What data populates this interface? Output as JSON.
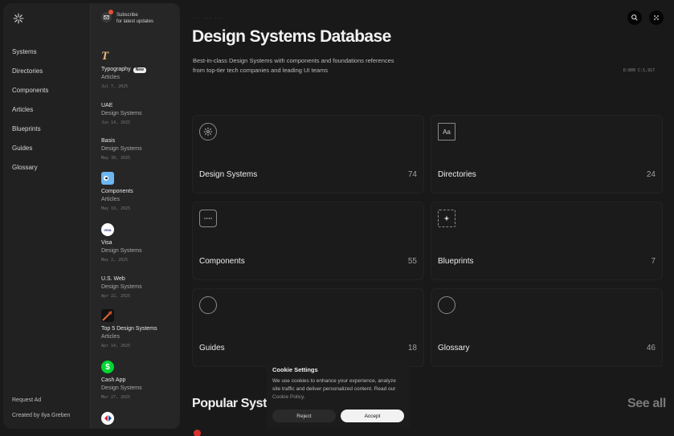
{
  "nav": {
    "items": [
      "Systems",
      "Directories",
      "Components",
      "Articles",
      "Blueprints",
      "Guides",
      "Glossary"
    ],
    "footer": [
      "Request Ad",
      "Created by Ilya Greben"
    ]
  },
  "subscribe": {
    "line1": "Subscribe",
    "line2": "for latest updates"
  },
  "feed": [
    {
      "title": "Typography",
      "badge": "New",
      "category": "Articles",
      "date": "Jul 7, 2025",
      "icon": "T"
    },
    {
      "title": "UAE",
      "category": "Design Systems",
      "date": "Jun 14, 2025",
      "icon": ""
    },
    {
      "title": "Basis",
      "category": "Design Systems",
      "date": "May 30, 2025",
      "icon": ""
    },
    {
      "title": "Components",
      "category": "Articles",
      "date": "May 19, 2025",
      "icon": ""
    },
    {
      "title": "Visa",
      "category": "Design Systems",
      "date": "May 2, 2025",
      "icon": "VISA"
    },
    {
      "title": "U.S. Web",
      "category": "Design Systems",
      "date": "Apr 22, 2025",
      "icon": ""
    },
    {
      "title": "Top 5 Design Systems",
      "category": "Articles",
      "date": "Apr 14, 2025",
      "icon": ""
    },
    {
      "title": "Cash App",
      "category": "Design Systems",
      "date": "Mar 27, 2025",
      "icon": "$"
    }
  ],
  "header": {
    "overline": "--- --- ---",
    "title": "Design Systems Database",
    "description": "Best-in-class Design Systems with components and foundations references from top-tier tech companies and leading UI teams",
    "coords": "D:809  C:1,917"
  },
  "cards": [
    {
      "title": "Design Systems",
      "count": "74",
      "icon": "sun-icon"
    },
    {
      "title": "Directories",
      "count": "24",
      "icon": "Aa"
    },
    {
      "title": "Components",
      "count": "55",
      "icon": "dots-icon"
    },
    {
      "title": "Blueprints",
      "count": "7",
      "icon": "sparkle-icon"
    },
    {
      "title": "Guides",
      "count": "18",
      "icon": "circle-icon"
    },
    {
      "title": "Glossary",
      "count": "46",
      "icon": "circle-icon"
    }
  ],
  "popular": {
    "title": "Popular Syste",
    "see_all": "See all"
  },
  "cookie": {
    "title": "Cookie Settings",
    "text": "We use cookies to enhance your experience, analyze site traffic and deliver personalized content. Read our ",
    "link": "Cookie Policy",
    "suffix": ".",
    "reject": "Reject",
    "accept": "Accept"
  }
}
